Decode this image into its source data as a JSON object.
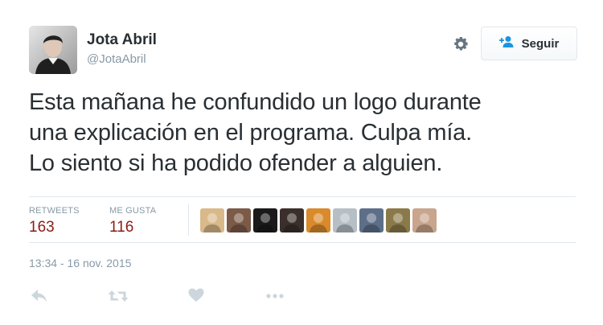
{
  "user": {
    "full_name": "Jota Abril",
    "username": "@JotaAbril",
    "avatar_icon": "profile-photo"
  },
  "header": {
    "settings_icon": "gear-icon",
    "follow_button": {
      "label": "Seguir",
      "icon": "add-person-icon"
    }
  },
  "tweet": {
    "lines": [
      "Esta mañana he confundido un logo durante",
      "una explicación en el programa. Culpa mía.",
      "Lo siento si ha podido ofender a alguien."
    ]
  },
  "stats": {
    "retweets_label": "RETWEETS",
    "retweets_value": "163",
    "likes_label": "ME GUSTA",
    "likes_value": "116"
  },
  "likers": [
    {
      "name": "liker-avatar-1",
      "color": "#d9b98a"
    },
    {
      "name": "liker-avatar-2",
      "color": "#7b5a48"
    },
    {
      "name": "liker-avatar-3",
      "color": "#1a1a1a"
    },
    {
      "name": "liker-avatar-4",
      "color": "#3a2f2a"
    },
    {
      "name": "liker-avatar-5",
      "color": "#d98a2b"
    },
    {
      "name": "liker-avatar-6",
      "color": "#b6bfc6"
    },
    {
      "name": "liker-avatar-7",
      "color": "#5d6f88"
    },
    {
      "name": "liker-avatar-8",
      "color": "#8a7a4a"
    },
    {
      "name": "liker-avatar-9",
      "color": "#c8a58c"
    }
  ],
  "timestamp": "13:34 - 16 nov. 2015",
  "actions": {
    "reply_icon": "reply-icon",
    "retweet_icon": "retweet-icon",
    "like_icon": "heart-icon",
    "more_icon": "more-icon"
  },
  "colors": {
    "text": "#292f33",
    "muted": "#8899a6",
    "stat_value": "#8c1b15",
    "divider": "#e1e8ed",
    "follow_icon": "#1b95e0"
  }
}
